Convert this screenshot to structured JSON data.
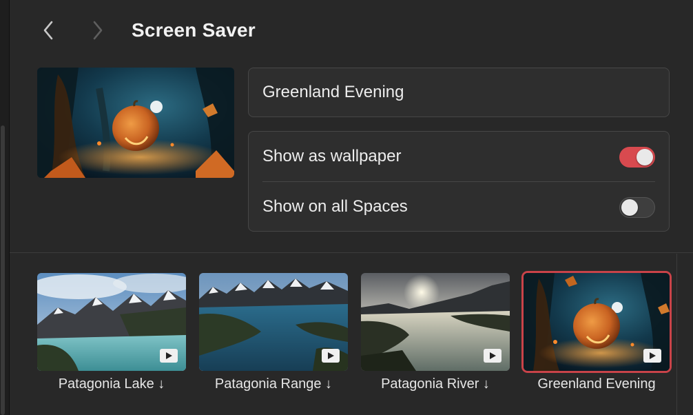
{
  "header": {
    "title": "Screen Saver",
    "back_icon": "chevron-left-icon",
    "forward_icon": "chevron-right-icon"
  },
  "preview": {
    "image": "pumpkin-forest-night"
  },
  "name_field": {
    "value": "Greenland Evening"
  },
  "settings": {
    "show_as_wallpaper": {
      "label": "Show as wallpaper",
      "enabled": true
    },
    "show_on_all_spaces": {
      "label": "Show on all Spaces",
      "enabled": false
    }
  },
  "gallery": {
    "items": [
      {
        "label": "Patagonia Lake ↓",
        "image": "patagonia-lake",
        "selected": false
      },
      {
        "label": "Patagonia Range ↓",
        "image": "patagonia-range",
        "selected": false
      },
      {
        "label": "Patagonia River ↓",
        "image": "patagonia-river",
        "selected": false
      },
      {
        "label": "Greenland Evening",
        "image": "pumpkin-forest-night",
        "selected": true
      }
    ],
    "badge_icon": "play-icon"
  },
  "colors": {
    "background": "#282828",
    "toggle_on": "#d84a4f",
    "selection": "#c94349"
  }
}
